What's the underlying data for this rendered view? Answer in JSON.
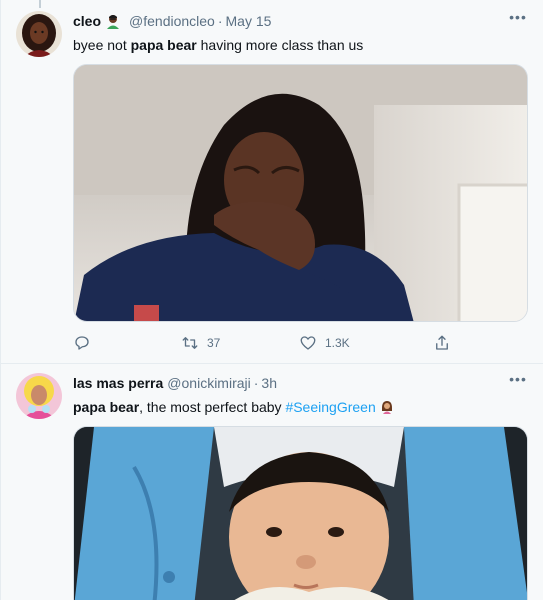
{
  "tweets": [
    {
      "name": "cleo",
      "badge_emoji": "scientist-emoji",
      "handle": "@fendioncleo",
      "separator": "·",
      "time": "May 15",
      "text_before": "byee not ",
      "text_bold": "papa bear",
      "text_after": " having more class than us",
      "media": "photo-woman-covering-mouth",
      "actions": {
        "reply_count": "",
        "retweet_count": "37",
        "like_count": "1.3K"
      }
    },
    {
      "name": "las mas perra",
      "handle": "@onickimiraji",
      "separator": "·",
      "time": "3h",
      "text_bold": "papa bear",
      "text_after": ", the most perfect baby ",
      "hashtag": "#SeeingGreen",
      "trailing_emoji": "woman-emoji",
      "media": "photo-baby"
    }
  ],
  "colors": {
    "background": "#f7f9fa",
    "text": "#0f1419",
    "secondary": "#5b7083",
    "link": "#1da1f2",
    "border": "#e6ecf0"
  }
}
